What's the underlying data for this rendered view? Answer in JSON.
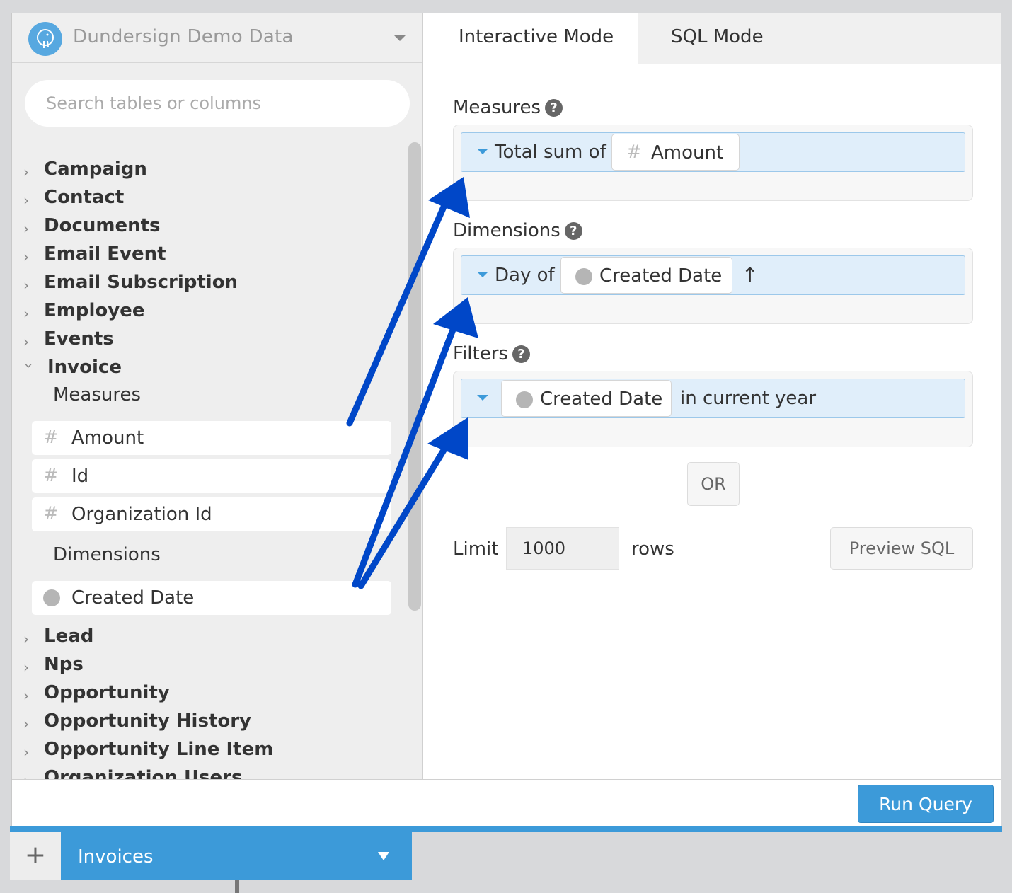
{
  "datasource": {
    "name": "Dundersign Demo Data",
    "icon": "postgres-elephant-icon"
  },
  "search": {
    "placeholder": "Search tables or columns"
  },
  "tables_above": [
    "Campaign",
    "Contact",
    "Documents",
    "Email Event",
    "Email Subscription",
    "Employee",
    "Events"
  ],
  "expanded_table": {
    "name": "Invoice",
    "measures_label": "Measures",
    "measures": [
      "Amount",
      "Id",
      "Organization Id"
    ],
    "dimensions_label": "Dimensions",
    "dimensions": [
      "Created Date"
    ]
  },
  "tables_below": [
    "Lead",
    "Nps",
    "Opportunity",
    "Opportunity History",
    "Opportunity Line Item",
    "Organization Users"
  ],
  "tabs": {
    "interactive": "Interactive Mode",
    "sql": "SQL Mode"
  },
  "builder": {
    "measures_label": "Measures",
    "measure": {
      "aggregation": "Total sum of",
      "field": "Amount"
    },
    "dimensions_label": "Dimensions",
    "dimension": {
      "granularity": "Day of",
      "field": "Created Date",
      "sort_icon": "↑"
    },
    "filters_label": "Filters",
    "filter": {
      "field": "Created Date",
      "condition": "in current year"
    },
    "or_label": "OR",
    "limit_label": "Limit",
    "limit_value": "1000",
    "rows_label": "rows",
    "preview_label": "Preview SQL",
    "help_glyph": "?"
  },
  "run_label": "Run Query",
  "query_tab": {
    "add_glyph": "+",
    "name": "Invoices"
  },
  "colors": {
    "accent": "#3c9ad9",
    "arrow": "#0047c8",
    "pill": "#e0eefa"
  }
}
